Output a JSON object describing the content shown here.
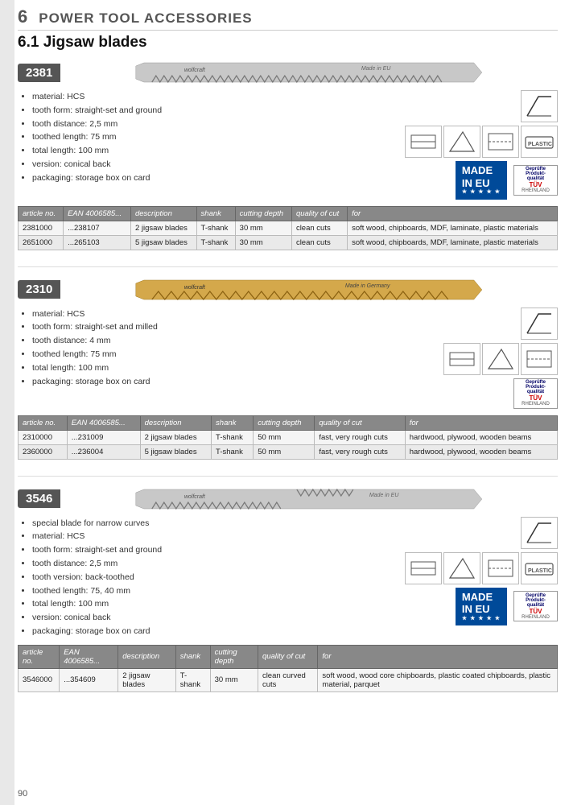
{
  "page": {
    "number": "90",
    "chapter_number": "6",
    "chapter_title": "POWER TOOL ACCESSORIES",
    "section_number": "6.1",
    "section_title": "Jigsaw blades"
  },
  "products": [
    {
      "id": "2381",
      "brand": "wolfcraft",
      "origin": "Made in EU",
      "origin_type": "eu",
      "specs": [
        "material: HCS",
        "tooth form: straight-set and ground",
        "tooth distance: 2,5 mm",
        "toothed length: 75 mm",
        "total length: 100 mm",
        "version: conical back",
        "packaging: storage box on card"
      ],
      "table": {
        "headers": [
          "article no.",
          "EAN 4006585...",
          "description",
          "shank",
          "cutting depth",
          "quality of cut",
          "for"
        ],
        "rows": [
          [
            "2381000",
            "...238107",
            "2 jigsaw blades",
            "T-shank",
            "30 mm",
            "clean cuts",
            "soft wood, chipboards, MDF, laminate, plastic materials"
          ],
          [
            "2651000",
            "...265103",
            "5 jigsaw blades",
            "T-shank",
            "30 mm",
            "clean cuts",
            "soft wood, chipboards, MDF, laminate, plastic materials"
          ]
        ]
      }
    },
    {
      "id": "2310",
      "brand": "wolfcraft",
      "origin": "Made in Germany",
      "origin_type": "germany",
      "specs": [
        "material: HCS",
        "tooth form: straight-set and milled",
        "tooth distance: 4 mm",
        "toothed length: 75 mm",
        "total length: 100 mm",
        "packaging: storage box on card"
      ],
      "table": {
        "headers": [
          "article no.",
          "EAN 4006585...",
          "description",
          "shank",
          "cutting depth",
          "quality of cut",
          "for"
        ],
        "rows": [
          [
            "2310000",
            "...231009",
            "2 jigsaw blades",
            "T-shank",
            "50 mm",
            "fast, very rough cuts",
            "hardwood, plywood, wooden beams"
          ],
          [
            "2360000",
            "...236004",
            "5 jigsaw blades",
            "T-shank",
            "50 mm",
            "fast, very rough cuts",
            "hardwood, plywood, wooden beams"
          ]
        ]
      }
    },
    {
      "id": "3546",
      "brand": "wolfcraft",
      "origin": "Made in EU",
      "origin_type": "eu",
      "specs": [
        "special blade for narrow curves",
        "material: HCS",
        "tooth form: straight-set and ground",
        "tooth distance: 2,5 mm",
        "tooth version: back-toothed",
        "toothed length: 75, 40 mm",
        "total length: 100 mm",
        "version: conical back",
        "packaging: storage box on card"
      ],
      "table": {
        "headers": [
          "article no.",
          "EAN 4006585...",
          "description",
          "shank",
          "cutting depth",
          "quality of cut",
          "for"
        ],
        "rows": [
          [
            "3546000",
            "...354609",
            "2 jigsaw blades",
            "T-shank",
            "30 mm",
            "clean curved cuts",
            "soft wood, wood core chipboards, plastic coated chipboards, plastic material, parquet"
          ]
        ]
      }
    }
  ]
}
